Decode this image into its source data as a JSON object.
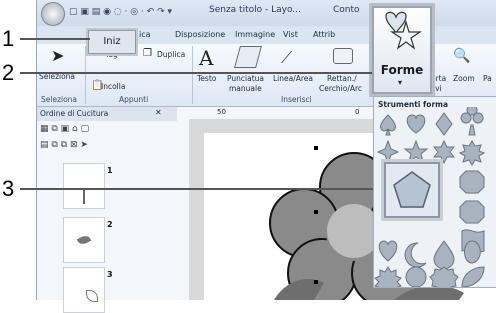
{
  "window": {
    "title": "Senza titolo - Layo...",
    "title_right": "Conto"
  },
  "tabs": [
    {
      "label": "ica"
    },
    {
      "label": "Disposizione"
    },
    {
      "label": "Immagine"
    },
    {
      "label": "Vist"
    },
    {
      "label": "Attrib"
    }
  ],
  "home_tab_label": "Iniz",
  "ribbon": {
    "tag": "Tag",
    "duplica": "Duplica",
    "seleziona": "Seleziona",
    "incolla": "Incolla",
    "testo": "Testo",
    "punciatua": "Punciatua",
    "manuale": "manuale",
    "linea_area": "Linea/Area",
    "rettan": "Rettan./",
    "cerchio_arco": "Cerchio/Arc",
    "forme": "Forme",
    "porta": "orta",
    "ivi": "ivi",
    "zoom": "Zoom",
    "pa": "Pa",
    "groups": {
      "seleziona": "Seleziona",
      "appunti": "Appunti",
      "inserisci": "Inserisci"
    }
  },
  "panel": {
    "title": "Ordine di Cucitura",
    "items": [
      {
        "num": "1"
      },
      {
        "num": "2"
      },
      {
        "num": "3"
      }
    ]
  },
  "ruler": {
    "marks": [
      "50",
      "0"
    ]
  },
  "dropdown": {
    "title": "Strumenti forma"
  },
  "callouts": {
    "one": "1",
    "two": "2",
    "three": "3"
  },
  "colors": {
    "flower_petal": "#8a8a8a",
    "flower_center": "#bdbdbd",
    "flower_outline": "#111111",
    "leaf": "#6e6e6e"
  }
}
